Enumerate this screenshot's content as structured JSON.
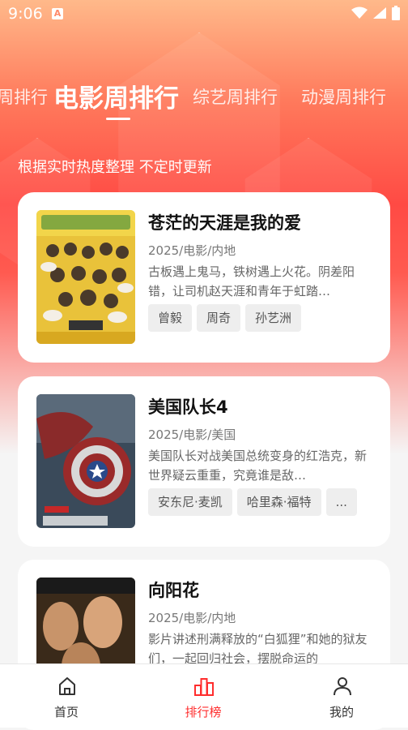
{
  "status_bar": {
    "time": "9:06",
    "app_badge": "A"
  },
  "tabs": [
    {
      "label": "周排行"
    },
    {
      "label": "电影周排行"
    },
    {
      "label": "综艺周排行"
    },
    {
      "label": "动漫周排行"
    }
  ],
  "subtitle": "根据实时热度整理 不定时更新",
  "movies": [
    {
      "title": "苍茫的天涯是我的爱",
      "meta": "2025/电影/内地",
      "desc": "古板遇上鬼马，铁树遇上火花。阴差阳错，让司机赵天涯和青年于虹踏…",
      "tags": [
        "曾毅",
        "周奇",
        "孙艺洲"
      ]
    },
    {
      "title": "美国队长4",
      "meta": "2025/电影/美国",
      "desc": "美国队长对战美国总统变身的红浩克，新世界疑云重重，究竟谁是敌…",
      "tags": [
        "安东尼·麦凯",
        "哈里森·福特",
        "..."
      ]
    },
    {
      "title": "向阳花",
      "meta": "2025/电影/内地",
      "desc": "影片讲述刑满释放的“白狐狸”和她的狱友们，一起回归社会，摆脱命运的",
      "tags": []
    }
  ],
  "bottom_nav": [
    {
      "label": "首页",
      "icon": "home-icon"
    },
    {
      "label": "排行榜",
      "icon": "ranking-icon",
      "active": true
    },
    {
      "label": "我的",
      "icon": "profile-icon"
    }
  ],
  "colors": {
    "accent": "#ff2d2d",
    "hero_top": "#ffb98a",
    "hero_mid": "#ff4a44"
  }
}
